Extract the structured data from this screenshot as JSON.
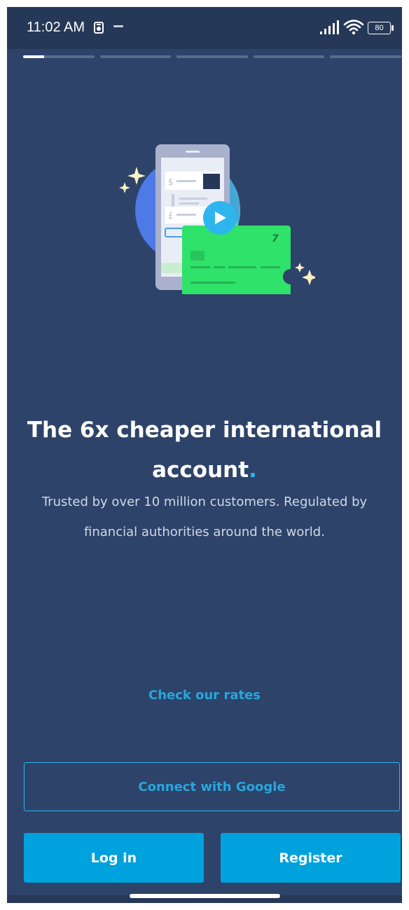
{
  "status_bar": {
    "time": "11:02 AM",
    "battery": "80",
    "icons": [
      "notification-icon",
      "signal-icon",
      "wifi-icon",
      "battery-icon"
    ]
  },
  "onboarding": {
    "progress": {
      "total_steps": 5,
      "current_step": 1,
      "current_fraction": 0.3
    },
    "headline": "The 6x cheaper international account",
    "headline_dot": ".",
    "subtext": "Trusted by over 10 million customers. Regulated by financial authorities around the world."
  },
  "illustration": {
    "phone_symbols": [
      "$",
      "£"
    ],
    "card_logo": "7",
    "icons": [
      "sparkle-icon",
      "play-icon",
      "card-logo-icon"
    ]
  },
  "actions": {
    "check_rates": "Check our rates",
    "connect_google": "Connect with Google",
    "login": "Log in",
    "register": "Register"
  },
  "colors": {
    "background": "#2e4369",
    "accent": "#00a2dd",
    "link": "#25a7df",
    "card_green": "#2fe26a",
    "globe_blue": "#4d7ae6",
    "globe_teal": "#59d3b6"
  }
}
